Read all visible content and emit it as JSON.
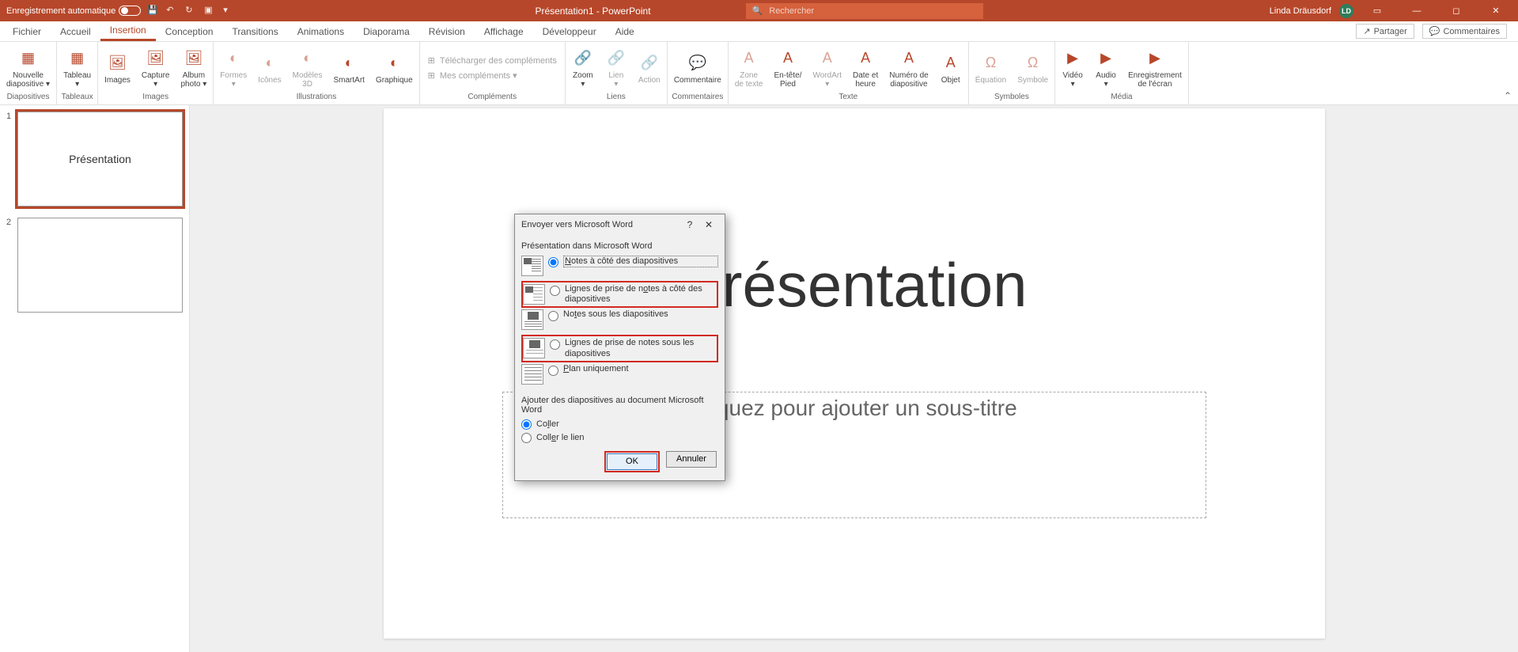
{
  "titlebar": {
    "autosave_label": "Enregistrement automatique",
    "app_title": "Présentation1 - PowerPoint",
    "search_placeholder": "Rechercher",
    "user_name": "Linda Dräusdorf",
    "user_initials": "LD"
  },
  "tabs": {
    "items": [
      "Fichier",
      "Accueil",
      "Insertion",
      "Conception",
      "Transitions",
      "Animations",
      "Diaporama",
      "Révision",
      "Affichage",
      "Développeur",
      "Aide"
    ],
    "active_index": 2,
    "share": "Partager",
    "comments": "Commentaires"
  },
  "ribbon": {
    "groups": [
      {
        "label": "Diapositives",
        "items": [
          {
            "name": "Nouvelle\ndiapositive ▾"
          }
        ]
      },
      {
        "label": "Tableaux",
        "items": [
          {
            "name": "Tableau\n▾"
          }
        ]
      },
      {
        "label": "Images",
        "items": [
          {
            "name": "Images"
          },
          {
            "name": "Capture\n▾"
          },
          {
            "name": "Album\nphoto ▾"
          }
        ]
      },
      {
        "label": "Illustrations",
        "items": [
          {
            "name": "Formes\n▾",
            "disabled": true
          },
          {
            "name": "Icônes",
            "disabled": true
          },
          {
            "name": "Modèles\n3D",
            "disabled": true
          },
          {
            "name": "SmartArt"
          },
          {
            "name": "Graphique"
          }
        ]
      },
      {
        "label": "Compléments",
        "stack": [
          "Télécharger des compléments",
          "Mes compléments ▾"
        ],
        "disabled": true
      },
      {
        "label": "Liens",
        "items": [
          {
            "name": "Zoom\n▾"
          },
          {
            "name": "Lien\n▾",
            "disabled": true
          },
          {
            "name": "Action",
            "disabled": true
          }
        ]
      },
      {
        "label": "Commentaires",
        "items": [
          {
            "name": "Commentaire"
          }
        ]
      },
      {
        "label": "Texte",
        "items": [
          {
            "name": "Zone\nde texte",
            "disabled": true
          },
          {
            "name": "En-tête/\nPied"
          },
          {
            "name": "WordArt\n▾",
            "disabled": true
          },
          {
            "name": "Date et\nheure"
          },
          {
            "name": "Numéro de\ndiapositive"
          },
          {
            "name": "Objet"
          }
        ]
      },
      {
        "label": "Symboles",
        "items": [
          {
            "name": "Équation",
            "disabled": true
          },
          {
            "name": "Symbole",
            "disabled": true
          }
        ]
      },
      {
        "label": "Média",
        "items": [
          {
            "name": "Vidéo\n▾"
          },
          {
            "name": "Audio\n▾"
          },
          {
            "name": "Enregistrement\nde l'écran"
          }
        ]
      }
    ]
  },
  "slides": {
    "thumbs": [
      {
        "num": "1",
        "title": "Présentation",
        "active": true
      },
      {
        "num": "2",
        "title": "",
        "active": false
      }
    ],
    "canvas_title": "Présentation",
    "canvas_subtitle": "Cliquez pour ajouter un sous-titre"
  },
  "dialog": {
    "title": "Envoyer vers Microsoft Word",
    "section1": "Présentation dans Microsoft Word",
    "options": [
      {
        "label_pre": "",
        "u": "N",
        "label_post": "otes à côté des diapositives",
        "icon": "notes-side",
        "checked": true,
        "highlight": false,
        "boxed": true
      },
      {
        "label_pre": "Lignes de prise de n",
        "u": "o",
        "label_post": "tes à côté des diapositives",
        "icon": "lines-side",
        "checked": false,
        "highlight": true,
        "boxed": false
      },
      {
        "label_pre": "No",
        "u": "t",
        "label_post": "es sous les diapositives",
        "icon": "notes-below",
        "checked": false,
        "highlight": false,
        "boxed": false
      },
      {
        "label_pre": "Lignes de prise de notes sous les diapositives",
        "u": "",
        "label_post": "",
        "icon": "lines-below",
        "checked": false,
        "highlight": true,
        "boxed": false
      },
      {
        "label_pre": "",
        "u": "P",
        "label_post": "lan uniquement",
        "icon": "outline",
        "checked": false,
        "highlight": false,
        "boxed": false
      }
    ],
    "section2": "Ajouter des diapositives au document Microsoft Word",
    "add_options": [
      {
        "label_pre": "Co",
        "u": "l",
        "label_post": "ler",
        "checked": true
      },
      {
        "label_pre": "Coll",
        "u": "e",
        "label_post": "r le lien",
        "checked": false
      }
    ],
    "ok": "OK",
    "cancel": "Annuler"
  }
}
